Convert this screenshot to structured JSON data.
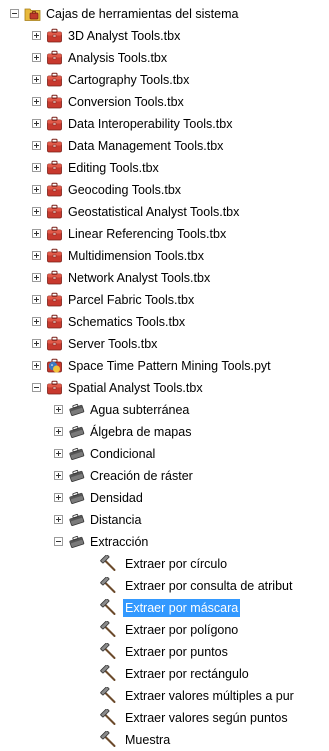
{
  "tree": {
    "root": {
      "label": "Cajas de herramientas del sistema",
      "icon": "system-toolboxes-folder-icon",
      "expanded": true
    },
    "toolboxes": [
      {
        "label": "3D Analyst Tools.tbx",
        "icon": "toolbox-icon",
        "expanded": false
      },
      {
        "label": "Analysis Tools.tbx",
        "icon": "toolbox-icon",
        "expanded": false
      },
      {
        "label": "Cartography Tools.tbx",
        "icon": "toolbox-icon",
        "expanded": false
      },
      {
        "label": "Conversion Tools.tbx",
        "icon": "toolbox-icon",
        "expanded": false
      },
      {
        "label": "Data Interoperability Tools.tbx",
        "icon": "toolbox-icon",
        "expanded": false
      },
      {
        "label": "Data Management Tools.tbx",
        "icon": "toolbox-icon",
        "expanded": false
      },
      {
        "label": "Editing Tools.tbx",
        "icon": "toolbox-icon",
        "expanded": false
      },
      {
        "label": "Geocoding Tools.tbx",
        "icon": "toolbox-icon",
        "expanded": false
      },
      {
        "label": "Geostatistical Analyst Tools.tbx",
        "icon": "toolbox-icon",
        "expanded": false
      },
      {
        "label": "Linear Referencing Tools.tbx",
        "icon": "toolbox-icon",
        "expanded": false
      },
      {
        "label": "Multidimension Tools.tbx",
        "icon": "toolbox-icon",
        "expanded": false
      },
      {
        "label": "Network Analyst Tools.tbx",
        "icon": "toolbox-icon",
        "expanded": false
      },
      {
        "label": "Parcel Fabric Tools.tbx",
        "icon": "toolbox-icon",
        "expanded": false
      },
      {
        "label": "Schematics Tools.tbx",
        "icon": "toolbox-icon",
        "expanded": false
      },
      {
        "label": "Server Tools.tbx",
        "icon": "toolbox-icon",
        "expanded": false
      },
      {
        "label": "Space Time Pattern Mining Tools.pyt",
        "icon": "python-toolbox-icon",
        "expanded": false
      },
      {
        "label": "Spatial Analyst Tools.tbx",
        "icon": "toolbox-icon",
        "expanded": true
      }
    ],
    "spatial_analyst_toolsets": [
      {
        "label": "Agua subterránea",
        "icon": "toolset-icon",
        "expanded": false
      },
      {
        "label": "Álgebra de mapas",
        "icon": "toolset-icon",
        "expanded": false
      },
      {
        "label": "Condicional",
        "icon": "toolset-icon",
        "expanded": false
      },
      {
        "label": "Creación de ráster",
        "icon": "toolset-icon",
        "expanded": false
      },
      {
        "label": "Densidad",
        "icon": "toolset-icon",
        "expanded": false
      },
      {
        "label": "Distancia",
        "icon": "toolset-icon",
        "expanded": false
      },
      {
        "label": "Extracción",
        "icon": "toolset-icon",
        "expanded": true
      }
    ],
    "extraccion_tools": [
      {
        "label": "Extraer por círculo",
        "icon": "tool-hammer-icon",
        "selected": false
      },
      {
        "label": "Extraer por consulta de atribut",
        "icon": "tool-hammer-icon",
        "selected": false
      },
      {
        "label": "Extraer por máscara",
        "icon": "tool-hammer-icon",
        "selected": true
      },
      {
        "label": "Extraer por polígono",
        "icon": "tool-hammer-icon",
        "selected": false
      },
      {
        "label": "Extraer por puntos",
        "icon": "tool-hammer-icon",
        "selected": false
      },
      {
        "label": "Extraer por rectángulo",
        "icon": "tool-hammer-icon",
        "selected": false
      },
      {
        "label": "Extraer valores múltiples a pur",
        "icon": "tool-hammer-icon",
        "selected": false
      },
      {
        "label": "Extraer valores según puntos",
        "icon": "tool-hammer-icon",
        "selected": false
      },
      {
        "label": "Muestra",
        "icon": "tool-hammer-icon",
        "selected": false
      }
    ]
  },
  "colors": {
    "selection": "#3399ff",
    "selection_text": "#ffffff",
    "toolbox_red": "#c0392b",
    "folder_yellow": "#e8b93c"
  }
}
